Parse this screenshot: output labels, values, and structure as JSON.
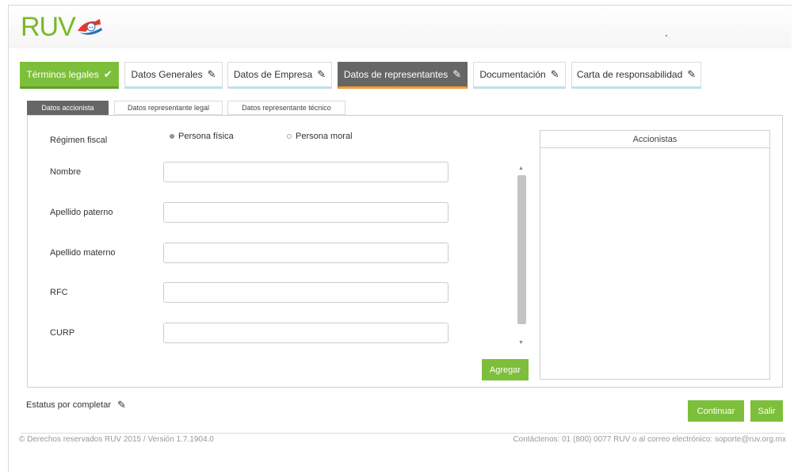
{
  "header": {
    "logo_text": "RUV"
  },
  "tabs": [
    {
      "label": "Términos legales",
      "icon": "check-icon",
      "state": "done"
    },
    {
      "label": "Datos Generales",
      "icon": "pencil-icon",
      "state": "default"
    },
    {
      "label": "Datos de Empresa",
      "icon": "pencil-icon",
      "state": "default"
    },
    {
      "label": "Datos de representantes",
      "icon": "pencil-icon",
      "state": "active"
    },
    {
      "label": "Documentación",
      "icon": "pencil-icon",
      "state": "default"
    },
    {
      "label": "Carta de responsabilidad",
      "icon": "pencil-icon",
      "state": "default"
    }
  ],
  "subtabs": [
    {
      "label": "Datos accionista",
      "state": "active"
    },
    {
      "label": "Datos representante legal",
      "state": "default"
    },
    {
      "label": "Datos representante técnico",
      "state": "default"
    }
  ],
  "form": {
    "regimen_label": "Régimen fiscal",
    "radio_fisica": "Persona física",
    "radio_moral": "Persona moral",
    "selected_regimen": "Persona física",
    "nombre_label": "Nombre",
    "apellido_paterno_label": "Apellido paterno",
    "apellido_materno_label": "Apellido materno",
    "rfc_label": "RFC",
    "curp_label": "CURP",
    "agregar_label": "Agregar"
  },
  "accionistas": {
    "header": "Accionistas"
  },
  "status": {
    "text": "Estatus por completar"
  },
  "buttons": {
    "continuar": "Continuar",
    "salir": "Salir"
  },
  "footer": {
    "left": "© Derechos reservados RUV 2015 / Versión 1.7.1904.0",
    "right": "Contáctenos: 01 (800) 0077 RUV o al correo electrónico: soporte@ruv.org.mx"
  },
  "colors": {
    "brand_green": "#7dbf3a",
    "active_tab": "#666666",
    "active_accent": "#f39c33",
    "tab_underline": "#bfe0e5"
  }
}
